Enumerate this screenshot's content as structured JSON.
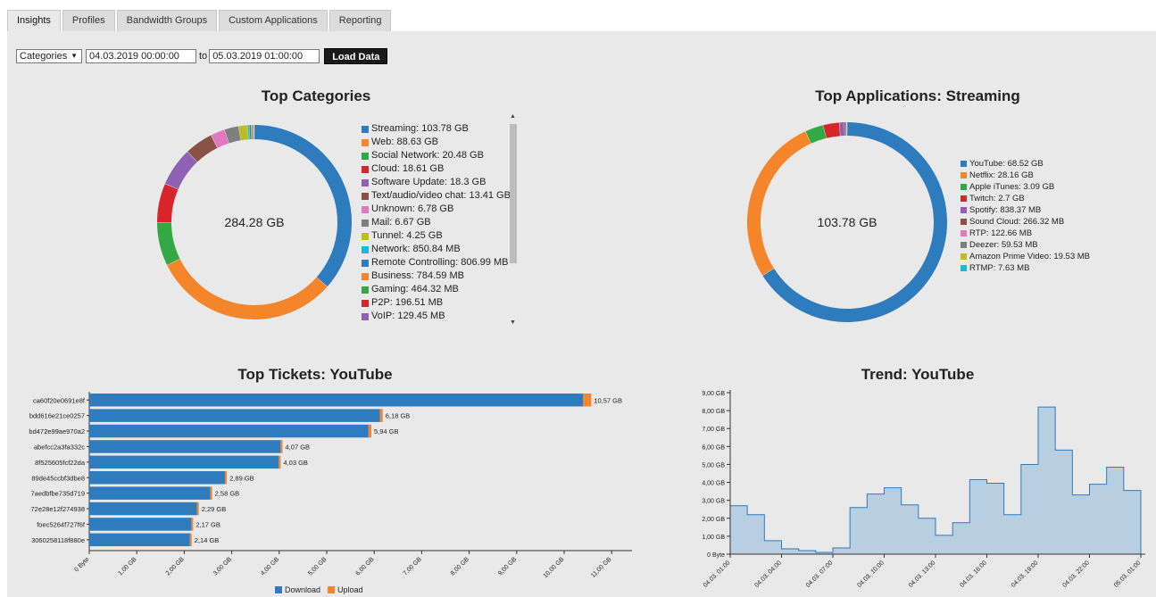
{
  "tabs": [
    "Insights",
    "Profiles",
    "Bandwidth Groups",
    "Custom Applications",
    "Reporting"
  ],
  "toolbar": {
    "category_select": "Categories",
    "from": "04.03.2019 00:00:00",
    "to_label": "to",
    "to": "05.03.2019 01:00:00",
    "load_button": "Load Data"
  },
  "colors": [
    "#2e7bbd",
    "#f5852a",
    "#33a845",
    "#d7262b",
    "#8e61b5",
    "#8a5245",
    "#e377c2",
    "#7f7f7f",
    "#bcbd22",
    "#17becf"
  ],
  "top_categories": {
    "title": "Top Categories",
    "total": "284.28 GB",
    "legend": [
      "Streaming: 103.78 GB",
      "Web: 88.63 GB",
      "Social Network: 20.48 GB",
      "Cloud: 18.61 GB",
      "Software Update: 18.3 GB",
      "Text/audio/video chat: 13.41 GB",
      "Unknown: 6.78 GB",
      "Mail: 6.67 GB",
      "Tunnel: 4.25 GB",
      "Network: 850.84 MB",
      "Remote Controlling: 806.99 MB",
      "Business: 784.59 MB",
      "Gaming: 464.32 MB",
      "P2P: 196.51 MB",
      "VoIP: 129.45 MB"
    ],
    "values_gb": [
      103.78,
      88.63,
      20.48,
      18.61,
      18.3,
      13.41,
      6.78,
      6.67,
      4.25,
      0.85,
      0.81,
      0.78,
      0.46,
      0.2,
      0.13
    ]
  },
  "top_applications": {
    "title": "Top Applications: Streaming",
    "total": "103.78 GB",
    "legend": [
      "YouTube: 68.52 GB",
      "Netflix: 28.16 GB",
      "Apple iTunes: 3.09 GB",
      "Twitch: 2.7 GB",
      "Spotify: 838.37 MB",
      "Sound Cloud: 266.32 MB",
      "RTP: 122.66 MB",
      "Deezer: 59.53 MB",
      "Amazon Prime Video: 19.53 MB",
      "RTMP: 7.63 MB"
    ],
    "values_gb": [
      68.52,
      28.16,
      3.09,
      2.7,
      0.84,
      0.27,
      0.12,
      0.06,
      0.02,
      0.01
    ]
  },
  "chart_data": [
    {
      "type": "bar",
      "title": "Top Tickets: YouTube",
      "categories": [
        "ca60f20e0691e8f",
        "bdd616e21ce0257",
        "bd472e99ae970a2",
        "abefcc2a3fa332c",
        "8f525605fcf22da",
        "89de45ccbf3dbe8",
        "7aedbfbe735d719",
        "72e28e12f274938",
        "foec5264f727f6f",
        "3060258118f880e"
      ],
      "series": [
        {
          "name": "Download",
          "values": [
            10.4,
            6.12,
            5.88,
            4.03,
            3.99,
            2.86,
            2.55,
            2.27,
            2.15,
            2.12
          ]
        },
        {
          "name": "Upload",
          "values": [
            0.17,
            0.06,
            0.06,
            0.04,
            0.04,
            0.03,
            0.03,
            0.02,
            0.02,
            0.02
          ]
        }
      ],
      "data_labels": [
        "10,57 GB",
        "6,18 GB",
        "5,94 GB",
        "4,07 GB",
        "4,03 GB",
        "2,89 GB",
        "2,58 GB",
        "2,29 GB",
        "2,17 GB",
        "2,14 GB"
      ],
      "xlim": [
        0,
        11.5
      ],
      "x_ticks": [
        "0 Byte",
        "1,00 GB",
        "2,00 GB",
        "3,00 GB",
        "4,00 GB",
        "5,00 GB",
        "6,00 GB",
        "7,00 GB",
        "8,00 GB",
        "9,00 GB",
        "10,00 GB",
        "11,00 GB"
      ],
      "legend": [
        "Download",
        "Upload"
      ]
    },
    {
      "type": "area",
      "title": "Trend: YouTube",
      "y_ticks": [
        "0 Byte",
        "1,00 GB",
        "2,00 GB",
        "3,00 GB",
        "4,00 GB",
        "5,00 GB",
        "6,00 GB",
        "7,00 GB",
        "8,00 GB",
        "9,00 GB"
      ],
      "ylim": [
        0,
        9
      ],
      "x_ticks": [
        "04.03. 01:00",
        "04.03. 04:00",
        "04.03. 07:00",
        "04.03. 10:00",
        "04.03. 13:00",
        "04.03. 16:00",
        "04.03. 19:00",
        "04.03. 22:00",
        "05.03. 01:00"
      ],
      "values": [
        2.7,
        2.2,
        0.75,
        0.3,
        0.2,
        0.1,
        0.35,
        2.6,
        3.35,
        3.7,
        2.75,
        2.0,
        1.05,
        1.75,
        4.15,
        3.95,
        2.2,
        5.0,
        8.2,
        5.8,
        3.3,
        3.9,
        4.85,
        3.55
      ]
    }
  ]
}
